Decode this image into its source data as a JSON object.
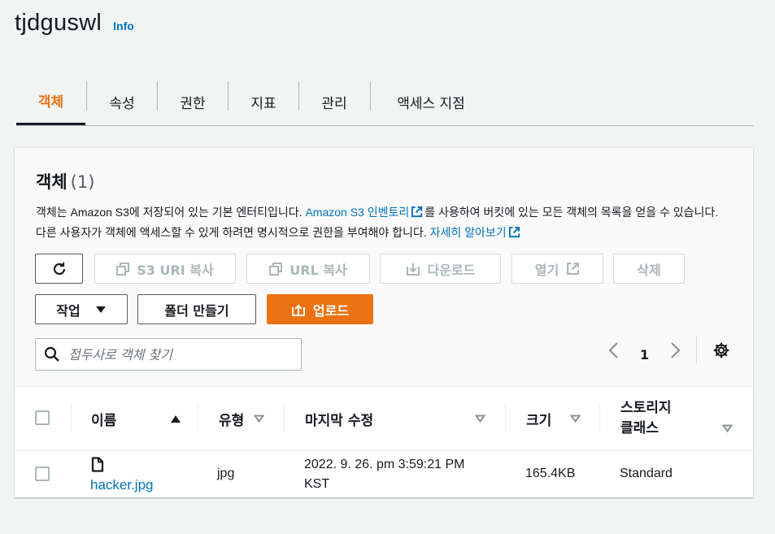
{
  "header": {
    "title": "tjdguswl",
    "info_label": "Info"
  },
  "tabs": [
    {
      "label": "객체",
      "active": true
    },
    {
      "label": "속성"
    },
    {
      "label": "권한"
    },
    {
      "label": "지표"
    },
    {
      "label": "관리"
    },
    {
      "label": "액세스 지점"
    }
  ],
  "objects_panel": {
    "title": "객체",
    "count": "(1)",
    "description": {
      "part1": "객체는 Amazon S3에 저장되어 있는 기본 엔터티입니다. ",
      "inventory_link": "Amazon S3 인벤토리",
      "part2": "를 사용하여 버킷에 있는 모든 객체의 목록을 얻을 수 있습니다. 다른 사용자가 객체에 액세스할 수 있게 하려면 명시적으로 권한을 부여해야 합니다. ",
      "learn_more_link": "자세히 알아보기"
    },
    "toolbar": {
      "copy_s3_uri": "S3 URI 복사",
      "copy_url": "URL 복사",
      "download": "다운로드",
      "open": "열기",
      "delete": "삭제",
      "actions": "작업",
      "create_folder": "폴더 만들기",
      "upload": "업로드"
    },
    "search": {
      "placeholder": "접두사로 객체 찾기"
    },
    "pagination": {
      "current_page": "1"
    },
    "table": {
      "columns": {
        "name": "이름",
        "type": "유형",
        "last_modified": "마지막 수정",
        "size": "크기",
        "storage_class_line1": "스토리지",
        "storage_class_line2": "클래스"
      },
      "rows": [
        {
          "name": "hacker.jpg",
          "type": "jpg",
          "last_modified_line1": "2022. 9. 26. pm 3:59:21 PM",
          "last_modified_line2": "KST",
          "size": "165.4KB",
          "storage_class": "Standard"
        }
      ]
    }
  },
  "colors": {
    "accent": "#ec7211",
    "link": "#0073bb",
    "text": "#16191f",
    "disabled": "#aab7b8"
  }
}
